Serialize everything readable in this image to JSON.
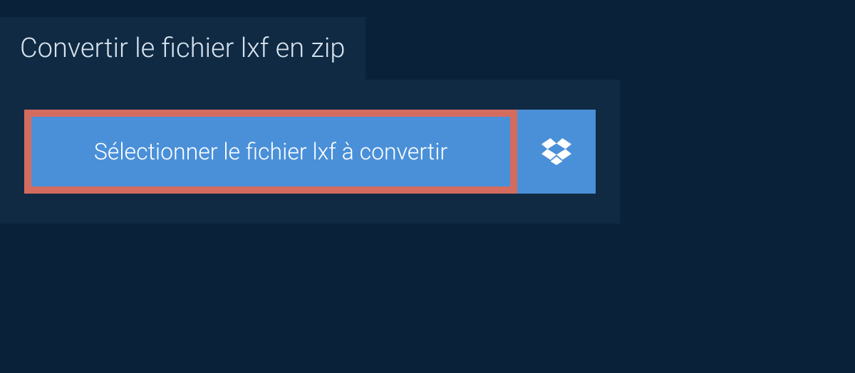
{
  "title": "Convertir le fichier lxf en zip",
  "selectButton": {
    "label": "Sélectionner le fichier lxf à convertir"
  },
  "colors": {
    "background": "#0a2239",
    "panel": "#102a43",
    "buttonBg": "#4a90d9",
    "highlightBorder": "#d36c5f",
    "text": "#d6e3ef",
    "buttonText": "#ffffff"
  }
}
